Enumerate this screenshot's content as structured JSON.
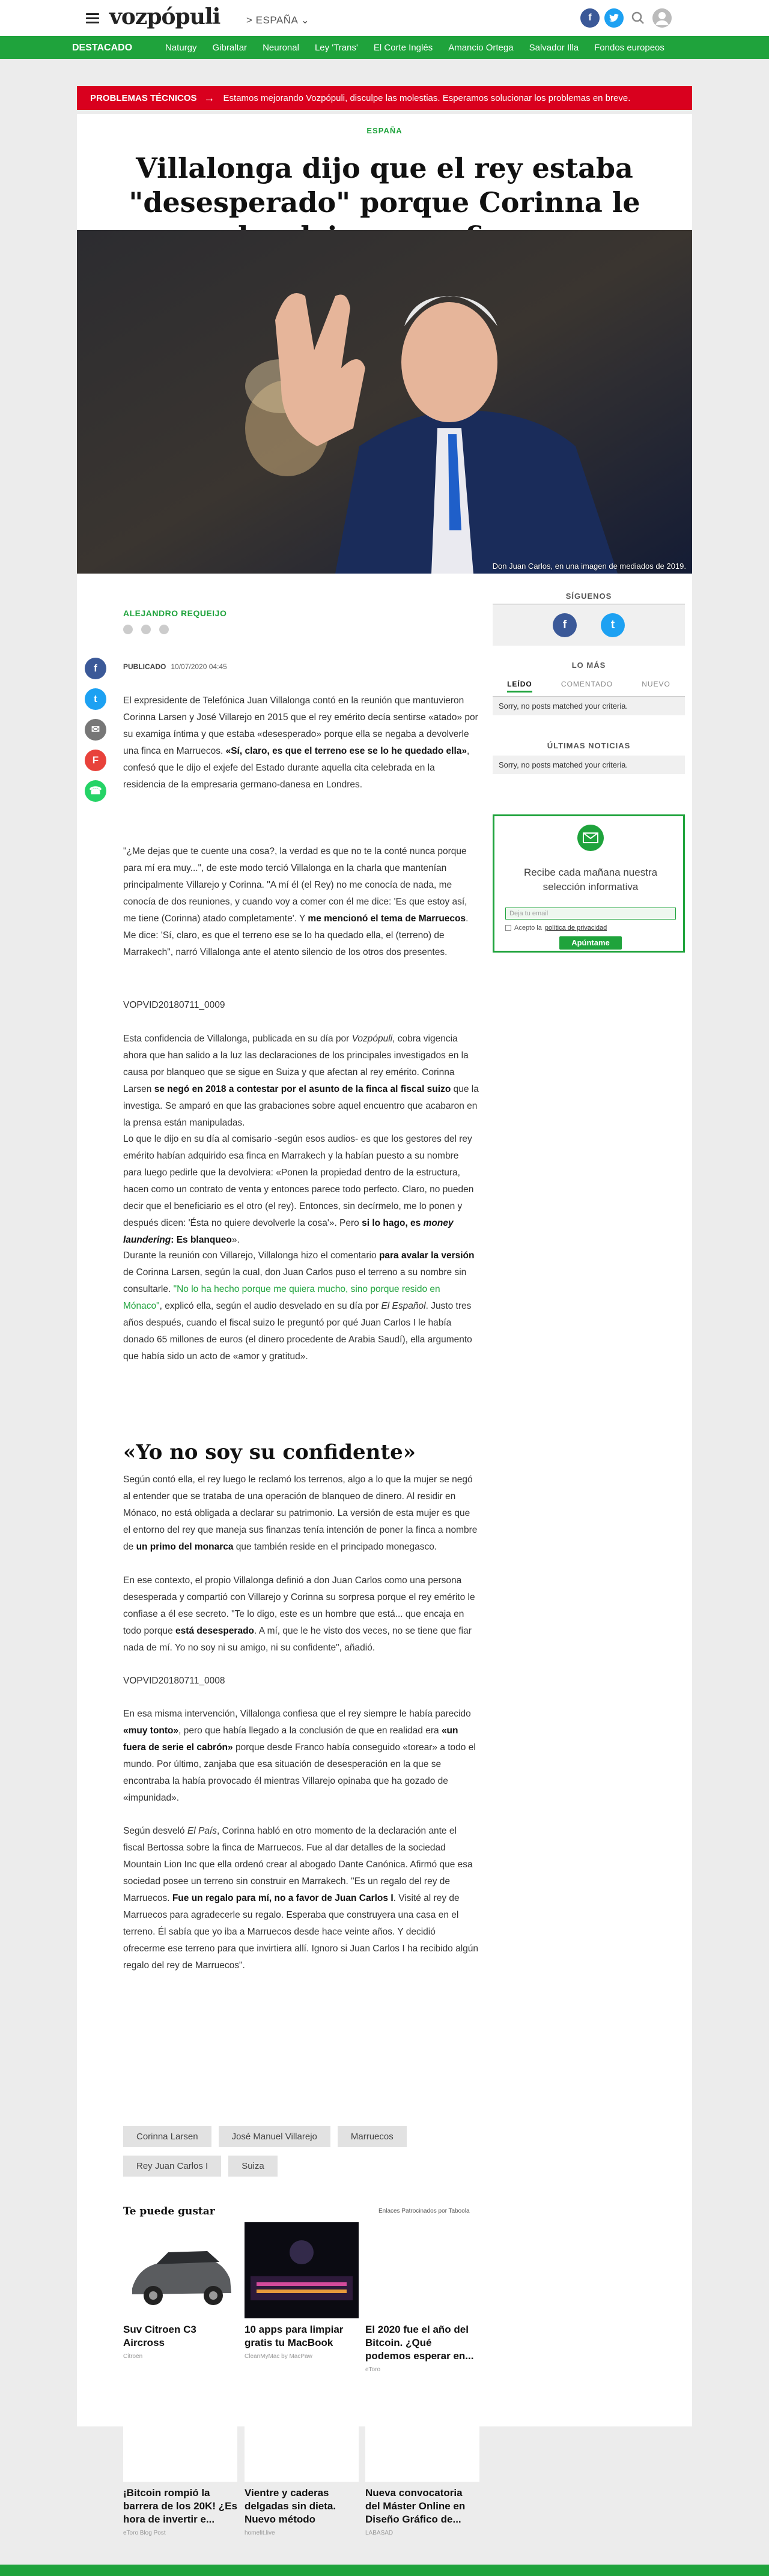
{
  "header": {
    "logo": "vozpópuli",
    "edition": "> ESPAÑA ⌄",
    "icons": [
      "facebook-icon",
      "twitter-icon",
      "search-icon",
      "user-icon"
    ]
  },
  "nav": {
    "label": "DESTACADO",
    "links": [
      "Naturgy",
      "Gibraltar",
      "Neuronal",
      "Ley 'Trans'",
      "El Corte Inglés",
      "Amancio Ortega",
      "Salvador Illa",
      "Fondos europeos"
    ]
  },
  "alert": {
    "title": "PROBLEMAS TÉCNICOS",
    "arrow": "→",
    "text": "Estamos mejorando Vozpópuli, disculpe las molestias. Esperamos solucionar los problemas en breve."
  },
  "article": {
    "section": "ESPAÑA",
    "headline": "Villalonga dijo que el rey estaba \"desesperado\" porque Corinna le devolviera una finca",
    "photo_caption": "Don Juan Carlos, en una imagen de mediados de 2019.",
    "author": "ALEJANDRO REQUEIJO",
    "published_label": "PUBLICADO",
    "published_date": "10/07/2020 04:45",
    "p1a": "El expresidente de Telefónica Juan Villalonga contó en la reunión que mantuvieron Corinna Larsen y José Villarejo en 2015 que el rey emérito decía sentirse «atado» por su examiga íntima y que estaba «desesperado» porque ella se negaba a devolverle una finca en Marruecos. ",
    "p1b": "«Sí, claro, es que el terreno ese se lo he quedado ella»",
    "p1c": ", confesó que le dijo el exjefe del Estado durante aquella cita celebrada en la residencia de la empresaria germano-danesa en Londres.",
    "p2a": "\"¿Me dejas que te cuente una cosa?, la verdad es que no te la conté nunca porque para mí era muy...\", de este modo terció Villalonga en la charla que mantenían principalmente Villarejo y Corinna. \"A mí él (el Rey) no me conocía de nada, me conocía de dos reuniones, y cuando voy a comer con él me dice: 'Es que estoy así, me tiene (Corinna) atado completamente'. Y ",
    "p2b": "me mencionó el tema de Marruecos",
    "p2c": ". Me dice: 'Sí, claro, es que el terreno ese se lo ha quedado ella, el (terreno) de Marrakech\", narró Villalonga ante el atento silencio de los otros dos presentes.",
    "vid1": "VOPVID20180711_0009",
    "p3a": "Esta confidencia de Villalonga, publicada en su día por ",
    "p3b": "Vozpópuli",
    "p3c": ", cobra vigencia ahora que han salido a la luz las declaraciones de los principales investigados en la causa por blanqueo que se sigue en Suiza y que afectan al rey emérito. Corinna Larsen ",
    "p3d": "se negó en 2018 a contestar por el asunto de la finca al fiscal suizo",
    "p3e": " que la investiga. Se amparó en que las grabaciones sobre aquel encuentro que acabaron en la prensa están manipuladas.",
    "p4a": "Lo que le dijo en su día al comisario -según esos audios- es que los gestores del rey emérito habían adquirido esa finca en Marrakech y la habían puesto a su nombre para luego pedirle que la devolviera: «Ponen la propiedad dentro de la estructura, hacen como un contrato de venta y entonces parece todo perfecto. Claro, no pueden decir que el beneficiario es el otro (el rey). Entonces, sin decírmelo, me lo ponen y después dicen: 'Ésta no quiere devolverle la cosa'». Pero ",
    "p4b": "si lo hago, es ",
    "p4c": "money laundering",
    "p4d": ": Es blanqueo",
    "p4e": "».",
    "p5a": "Durante la reunión con Villarejo, Villalonga hizo el comentario ",
    "p5b": "para avalar la versión",
    "p5c": " de Corinna Larsen, según la cual, don Juan Carlos puso el terreno a su nombre sin consultarle. ",
    "p5d": "\"No lo ha hecho porque me quiera mucho, sino porque resido en Mónaco\"",
    "p5e": ", explicó ella, según el audio desvelado en su día por ",
    "p5f": "El Español",
    "p5g": ". Justo tres años después, cuando el fiscal suizo le preguntó por qué Juan Carlos I le había donado 65 millones de euros (el dinero procedente de Arabia Saudí), ella argumento que había sido un acto de «amor y gratitud».",
    "subhead": "«Yo no soy su confidente»",
    "p6a": "Según contó ella, el rey luego le reclamó los terrenos, algo a lo que la mujer se negó al entender que se trataba de una operación de blanqueo de dinero. Al residir en Mónaco, no está obligada a declarar su patrimonio. La versión de esta mujer es que el entorno del rey que maneja sus finanzas tenía intención de poner la finca a nombre de ",
    "p6b": "un primo del monarca",
    "p6c": " que también reside en el principado monegasco.",
    "p7a": "En ese contexto, el propio Villalonga definió a don Juan Carlos como una persona desesperada y compartió con Villarejo y Corinna su sorpresa porque el rey emérito le confiase a él ese secreto. \"Te lo digo, este es un hombre que está... que encaja en todo porque ",
    "p7b": "está desesperado",
    "p7c": ". A mí, que le he visto dos veces, no se tiene que fiar nada de mí. Yo no soy ni su amigo, ni su confidente\", añadió.",
    "vid2": "VOPVID20180711_0008",
    "p8a": "En esa misma intervención, Villalonga confiesa que el rey siempre le había parecido ",
    "p8b": "«muy tonto»",
    "p8c": ", pero que había llegado a la conclusión de que en realidad era ",
    "p8d": "«un fuera de serie el cabrón»",
    "p8e": " porque desde Franco había conseguido «torear» a todo el mundo. Por último, zanjaba que esa situación de desesperación en la que se encontraba la había provocado él mientras Villarejo opinaba que ha gozado de «impunidad».",
    "p9a": "Según desveló ",
    "p9b": "El País",
    "p9c": ", Corinna habló en otro momento de la declaración ante el fiscal Bertossa sobre la finca de Marruecos. Fue al dar detalles de la sociedad Mountain Lion Inc que ella ordenó crear al abogado Dante Canónica. Afirmó que esa sociedad posee un terreno sin construir en Marrakech. \"Es un regalo del rey de Marruecos. ",
    "p9d": "Fue un regalo para mí, no a favor de Juan Carlos I",
    "p9e": ". Visité al rey de Marruecos para agradecerle su regalo. Esperaba que construyera una casa en el terreno. Él sabía que yo iba a Marruecos desde hace veinte años. Y decidió ofrecerme ese terreno para que invirtiera allí. Ignoro si Juan Carlos I ha recibido algún regalo del rey de Marruecos\"."
  },
  "sidebar": {
    "follow_title": "SÍGUENOS",
    "most_title": "LO MÁS",
    "tabs": [
      "LEÍDO",
      "COMENTADO",
      "NUEVO"
    ],
    "sorry1": "Sorry, no posts matched your criteria.",
    "latest_title": "ÚLTIMAS NOTICIAS",
    "sorry2": "Sorry, no posts matched your criteria.",
    "newsletter": {
      "text": "Recibe cada mañana nuestra selección informativa",
      "placeholder": "Deja tu email",
      "accept": "Acepto la",
      "policy": "política de privacidad",
      "button": "Apúntame"
    }
  },
  "tags": [
    "Corinna Larsen",
    "José Manuel Villarejo",
    "Marruecos",
    "Rey Juan Carlos I",
    "Suiza"
  ],
  "recommendations": {
    "title": "Te puede gustar",
    "sponsored": "Enlaces Patrocinados por Taboola",
    "items": [
      {
        "title": "Suv Citroen C3 Aircross",
        "source": "Citroën"
      },
      {
        "title": "10 apps para limpiar gratis tu MacBook",
        "source": "CleanMyMac by MacPaw"
      },
      {
        "title": "El 2020 fue el año del Bitcoin. ¿Qué podemos esperar en...",
        "source": "eToro"
      },
      {
        "title": "¡Bitcoin rompió la barrera de los 20K! ¿Es hora de invertir e...",
        "source": "eToro Blog Post"
      },
      {
        "title": "Vientre y caderas delgadas sin dieta. Nuevo método",
        "source": "homefit.live"
      },
      {
        "title": "Nueva convocatoria del Máster Online en Diseño Gráfico de...",
        "source": "LABASAD"
      }
    ]
  }
}
